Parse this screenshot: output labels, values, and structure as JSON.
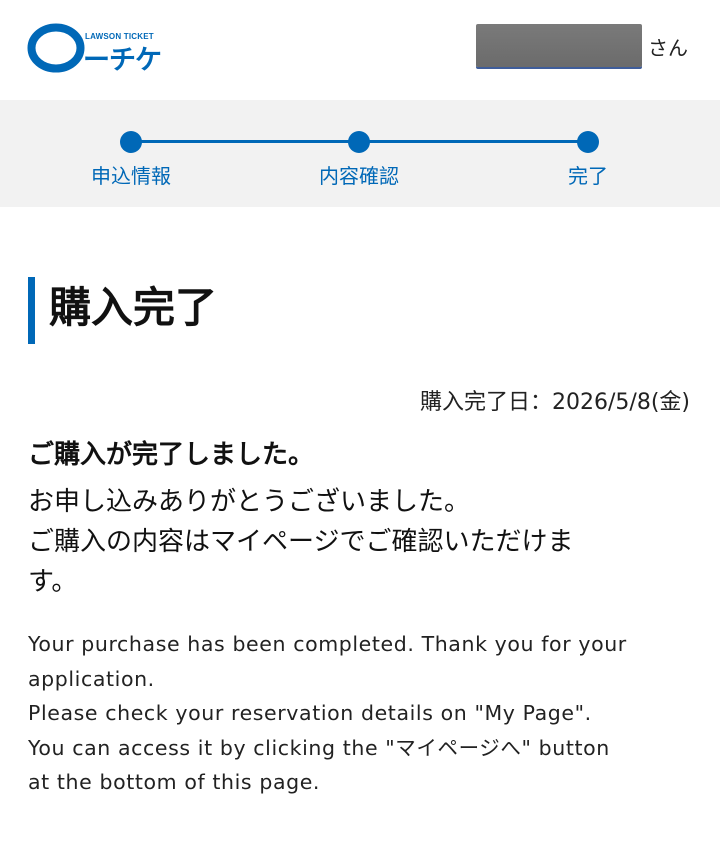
{
  "header": {
    "logo_sub": "LAWSON TICKET",
    "logo_main": "ーチケ",
    "user_suffix": "さん",
    "brand_color": "#0068b7"
  },
  "steps": [
    {
      "label": "申込情報"
    },
    {
      "label": "内容確認"
    },
    {
      "label": "完了"
    }
  ],
  "main": {
    "title": "購入完了",
    "date_label": "購入完了日：2026/5/8(金)",
    "done_message": "ご購入が完了しました。",
    "jp_message": [
      "お申し込みありがとうございました。",
      "ご購入の内容はマイページでご確認いただけま",
      "す。"
    ],
    "en_message": [
      "Your purchase has been completed. Thank you for your",
      "application.",
      "Please check your reservation details on \"My Page\".",
      "You can access it by clicking the \"マイページへ\" button",
      "at the bottom of this page."
    ]
  }
}
